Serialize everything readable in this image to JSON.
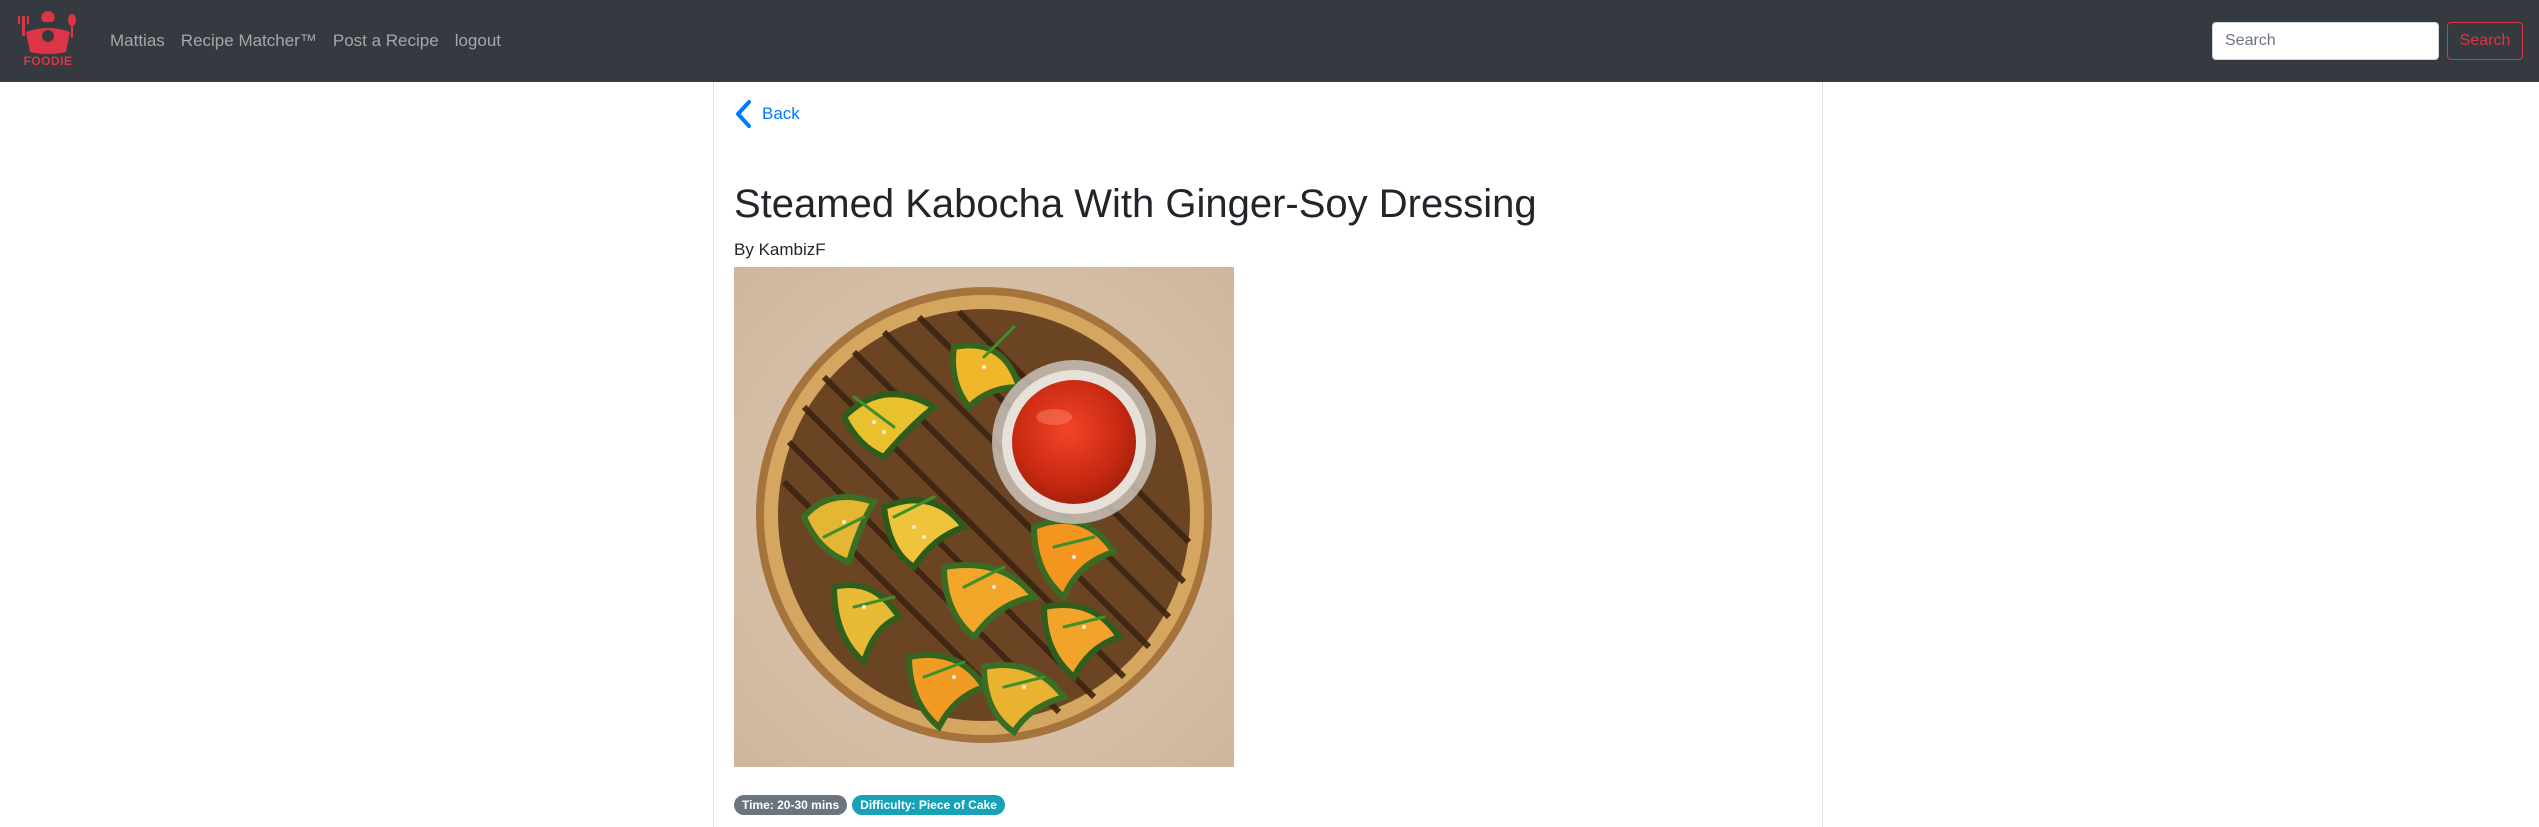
{
  "navbar": {
    "brand_text": "FOODIE",
    "links": [
      {
        "label": "Mattias"
      },
      {
        "label": "Recipe Matcher™"
      },
      {
        "label": "Post a Recipe"
      },
      {
        "label": "logout"
      }
    ],
    "search": {
      "placeholder": "Search",
      "button_label": "Search"
    }
  },
  "recipe": {
    "back_label": "Back",
    "title": "Steamed Kabocha With Ginger-Soy Dressing",
    "by_prefix": "By",
    "author": "KambizF",
    "badges": {
      "time": "Time: 20-30 mins",
      "difficulty": "Difficulty: Piece of Cake"
    }
  },
  "colors": {
    "navbar_bg": "#343a40",
    "brand_red": "#dc3545",
    "link_blue": "#007bff",
    "badge_time": "#6c757d",
    "badge_difficulty": "#17a2b8"
  }
}
